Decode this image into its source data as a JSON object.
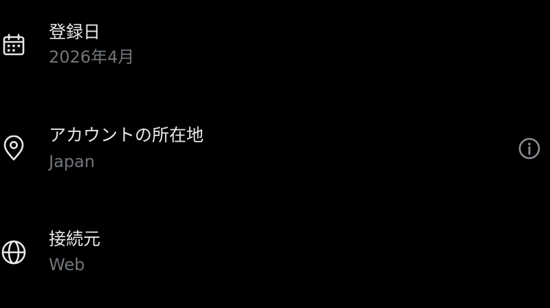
{
  "rows": [
    {
      "title": "登録日",
      "value": "2026年4月",
      "icon": "calendar-icon"
    },
    {
      "title": "アカウントの所在地",
      "value": "Japan",
      "icon": "location-pin-icon",
      "action_icon": "info-icon"
    },
    {
      "title": "接続元",
      "value": "Web",
      "icon": "globe-icon"
    }
  ],
  "colors": {
    "background": "#000000",
    "primary_text": "#e7e9ea",
    "secondary_text": "#71767b",
    "icon": "#e7e9ea",
    "info_icon": "#8b8f94"
  }
}
